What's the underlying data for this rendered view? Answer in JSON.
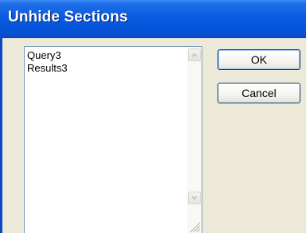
{
  "dialog": {
    "title": "Unhide Sections"
  },
  "sections_list": {
    "items": [
      "Query3",
      "Results3"
    ]
  },
  "buttons": {
    "ok_label": "OK",
    "cancel_label": "Cancel"
  },
  "icons": {
    "scroll_up": "chevron-up-icon",
    "scroll_down": "chevron-down-icon",
    "resize_grip": "resize-grip-icon"
  },
  "colors": {
    "titlebar": "#0a5be0",
    "dialog_bg": "#ece9d8",
    "button_border": "#003c74"
  }
}
